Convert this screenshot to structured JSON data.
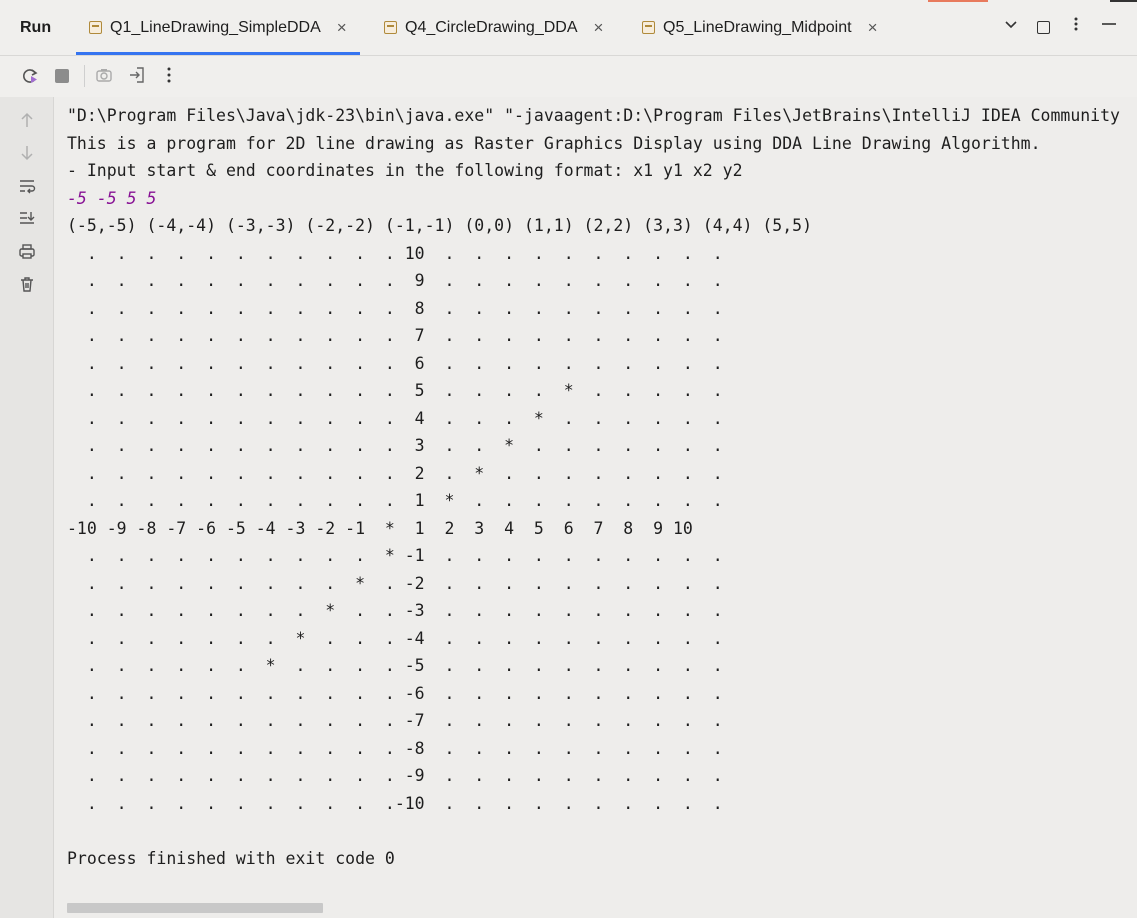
{
  "run_panel": {
    "title": "Run",
    "tabs": [
      {
        "label": "Q1_LineDrawing_SimpleDDA",
        "active": true
      },
      {
        "label": "Q4_CircleDrawing_DDA",
        "active": false
      },
      {
        "label": "Q5_LineDrawing_Midpoint",
        "active": false
      }
    ],
    "tab_close_glyph": "×"
  },
  "toolbar": {
    "icons": [
      "rerun-icon",
      "stop-icon",
      "screenshot-icon",
      "exit-icon",
      "more-options-icon"
    ]
  },
  "gutter": {
    "icons": [
      "scroll-up-icon",
      "scroll-down-icon",
      "soft-wrap-icon",
      "scroll-to-end-icon",
      "print-icon",
      "clear-all-icon"
    ]
  },
  "console": {
    "lines": [
      "\"D:\\Program Files\\Java\\jdk-23\\bin\\java.exe\" \"-javaagent:D:\\Program Files\\JetBrains\\IntelliJ IDEA Community",
      "This is a program for 2D line drawing as Raster Graphics Display using DDA Line Drawing Algorithm.",
      "- Input start & end coordinates in the following format: x1 y1 x2 y2",
      "-5 -5 5 5",
      "(-5,-5) (-4,-4) (-3,-3) (-2,-2) (-1,-1) (0,0) (1,1) (2,2) (3,3) (4,4) (5,5)",
      "  .  .  .  .  .  .  .  .  .  .  . 10  .  .  .  .  .  .  .  .  .  .",
      "  .  .  .  .  .  .  .  .  .  .  .  9  .  .  .  .  .  .  .  .  .  .",
      "  .  .  .  .  .  .  .  .  .  .  .  8  .  .  .  .  .  .  .  .  .  .",
      "  .  .  .  .  .  .  .  .  .  .  .  7  .  .  .  .  .  .  .  .  .  .",
      "  .  .  .  .  .  .  .  .  .  .  .  6  .  .  .  .  .  .  .  .  .  .",
      "  .  .  .  .  .  .  .  .  .  .  .  5  .  .  .  .  *  .  .  .  .  .",
      "  .  .  .  .  .  .  .  .  .  .  .  4  .  .  .  *  .  .  .  .  .  .",
      "  .  .  .  .  .  .  .  .  .  .  .  3  .  .  *  .  .  .  .  .  .  .",
      "  .  .  .  .  .  .  .  .  .  .  .  2  .  *  .  .  .  .  .  .  .  .",
      "  .  .  .  .  .  .  .  .  .  .  .  1  *  .  .  .  .  .  .  .  .  .",
      "-10 -9 -8 -7 -6 -5 -4 -3 -2 -1  *  1  2  3  4  5  6  7  8  9 10",
      "  .  .  .  .  .  .  .  .  .  .  * -1  .  .  .  .  .  .  .  .  .  .",
      "  .  .  .  .  .  .  .  .  .  *  . -2  .  .  .  .  .  .  .  .  .  .",
      "  .  .  .  .  .  .  .  .  *  .  . -3  .  .  .  .  .  .  .  .  .  .",
      "  .  .  .  .  .  .  .  *  .  .  . -4  .  .  .  .  .  .  .  .  .  .",
      "  .  .  .  .  .  .  *  .  .  .  . -5  .  .  .  .  .  .  .  .  .  .",
      "  .  .  .  .  .  .  .  .  .  .  . -6  .  .  .  .  .  .  .  .  .  .",
      "  .  .  .  .  .  .  .  .  .  .  . -7  .  .  .  .  .  .  .  .  .  .",
      "  .  .  .  .  .  .  .  .  .  .  . -8  .  .  .  .  .  .  .  .  .  .",
      "  .  .  .  .  .  .  .  .  .  .  . -9  .  .  .  .  .  .  .  .  .  .",
      "  .  .  .  .  .  .  .  .  .  .  .-10  .  .  .  .  .  .  .  .  .  .",
      "",
      "Process finished with exit code 0"
    ]
  }
}
